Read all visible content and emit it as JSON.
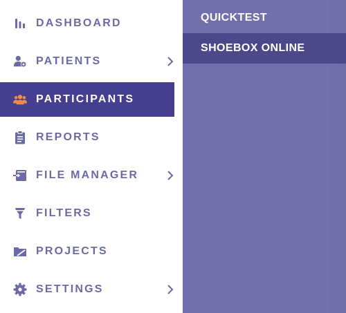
{
  "sidebar": {
    "items": [
      {
        "label": "DASHBOARD",
        "icon": "bar-chart-icon"
      },
      {
        "label": "PATIENTS",
        "icon": "add-user-icon",
        "has_submenu": true
      },
      {
        "label": "PARTICIPANTS",
        "icon": "users-group-icon",
        "active": true
      },
      {
        "label": "REPORTS",
        "icon": "clipboard-icon"
      },
      {
        "label": "FILE MANAGER",
        "icon": "file-import-icon",
        "has_submenu": true
      },
      {
        "label": "FILTERS",
        "icon": "funnel-icon"
      },
      {
        "label": "PROJECTS",
        "icon": "folder-icon"
      },
      {
        "label": "SETTINGS",
        "icon": "gear-icon",
        "has_submenu": true
      }
    ]
  },
  "submenu": {
    "items": [
      {
        "label": "QUICKTEST"
      },
      {
        "label": "SHOEBOX ONLINE",
        "selected": true
      }
    ]
  },
  "colors": {
    "text": "#6a6aa6",
    "active_bg": "#463e8e",
    "active_icon": "#f08a4b",
    "submenu_bg": "#716fac",
    "submenu_selected_bg": "#4d4888"
  }
}
